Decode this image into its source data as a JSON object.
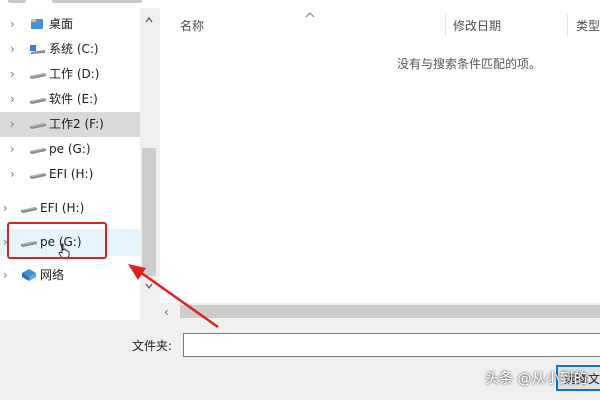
{
  "nav": {
    "items": [
      {
        "label": "桌面",
        "icon": "desktop-folder-icon"
      },
      {
        "label": "系统 (C:)",
        "icon": "system-drive-icon"
      },
      {
        "label": "工作 (D:)",
        "icon": "drive-icon"
      },
      {
        "label": "软件 (E:)",
        "icon": "drive-icon"
      },
      {
        "label": "工作2 (F:)",
        "icon": "drive-icon",
        "state": "selected"
      },
      {
        "label": "pe (G:)",
        "icon": "drive-icon"
      },
      {
        "label": "EFI (H:)",
        "icon": "drive-icon"
      },
      {
        "label": "EFI (H:)",
        "icon": "drive-icon"
      },
      {
        "label": "pe (G:)",
        "icon": "drive-icon",
        "state": "hover"
      },
      {
        "label": "网络",
        "icon": "network-icon"
      }
    ]
  },
  "list": {
    "columns": [
      "名称",
      "修改日期",
      "类型"
    ],
    "empty_message": "没有与搜索条件匹配的项。"
  },
  "footer": {
    "folder_label": "文件夹:",
    "folder_value": "",
    "select_button_label": "选择文件夹"
  },
  "watermark": {
    "text": "头条 @从小到的"
  },
  "colors": {
    "annotation_red": "#e02020",
    "accent_blue": "#0078d7",
    "selected_bg": "#d9d9d9",
    "hover_bg": "#e5f3fb"
  }
}
